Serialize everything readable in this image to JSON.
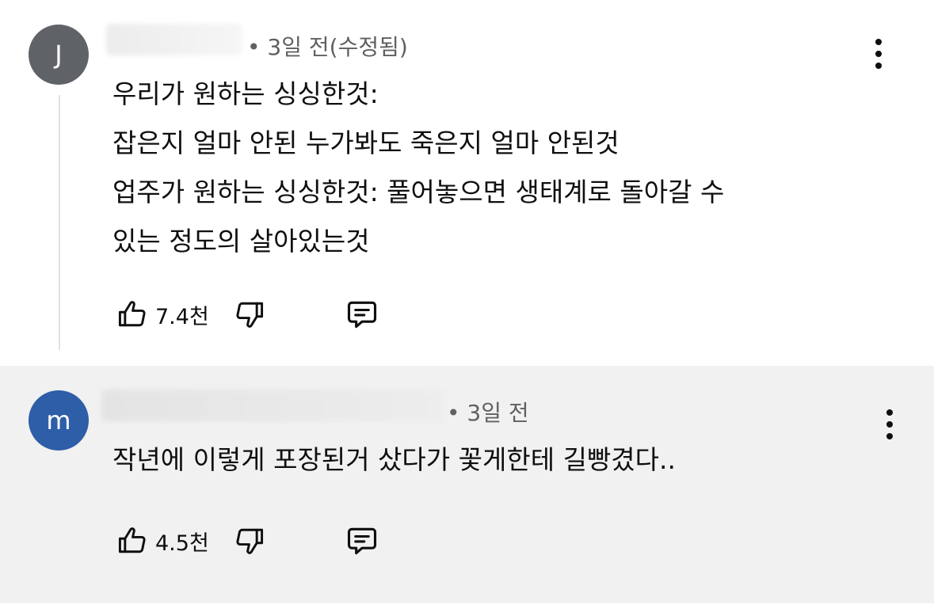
{
  "comments": [
    {
      "avatar_letter": "J",
      "avatar_color": "#5f6368",
      "meta": "• 3일 전(수정됨)",
      "lines": [
        "우리가 원하는 싱싱한것:",
        "잡은지 얼마 안된 누가봐도 죽은지 얼마 안된것",
        "업주가 원하는 싱싱한것: 풀어놓으면 생태계로 돌아갈 수",
        "있는 정도의 살아있는것"
      ],
      "like_count": "7.4천"
    },
    {
      "avatar_letter": "m",
      "avatar_color": "#2e5ea8",
      "meta": "• 3일 전",
      "lines": [
        "작년에 이렇게 포장된거 샀다가 꽃게한테 길빵겼다.."
      ],
      "like_count": "4.5천"
    }
  ],
  "icons": {
    "more": "more-vert-icon",
    "like": "thumb-up-icon",
    "dislike": "thumb-down-icon",
    "reply": "comment-reply-icon"
  },
  "colors": {
    "highlight_background": "#f1f1f1",
    "meta_text": "#606060"
  }
}
